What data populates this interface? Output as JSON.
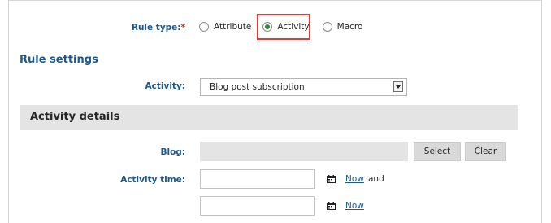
{
  "rule_type": {
    "label": "Rule type:",
    "required_marker": "*",
    "options": [
      {
        "label": "Attribute",
        "selected": false
      },
      {
        "label": "Activity",
        "selected": true
      },
      {
        "label": "Macro",
        "selected": false
      }
    ]
  },
  "rule_settings": {
    "title": "Rule settings",
    "activity_label": "Activity:",
    "activity_value": "Blog post subscription"
  },
  "activity_details": {
    "title": "Activity details",
    "blog_label": "Blog:",
    "select_button": "Select",
    "clear_button": "Clear",
    "activity_time_label": "Activity time:",
    "now_link_1": "Now",
    "and_text": "and",
    "now_link_2": "Now"
  },
  "colors": {
    "label_blue": "#1a5a91",
    "required_red": "#d9241b",
    "highlight_red": "#e03a3a",
    "radio_green": "#2e8a3c",
    "band_gray": "#e4e4e4"
  },
  "icons": [
    "calendar-icon",
    "dropdown-arrow-icon"
  ]
}
